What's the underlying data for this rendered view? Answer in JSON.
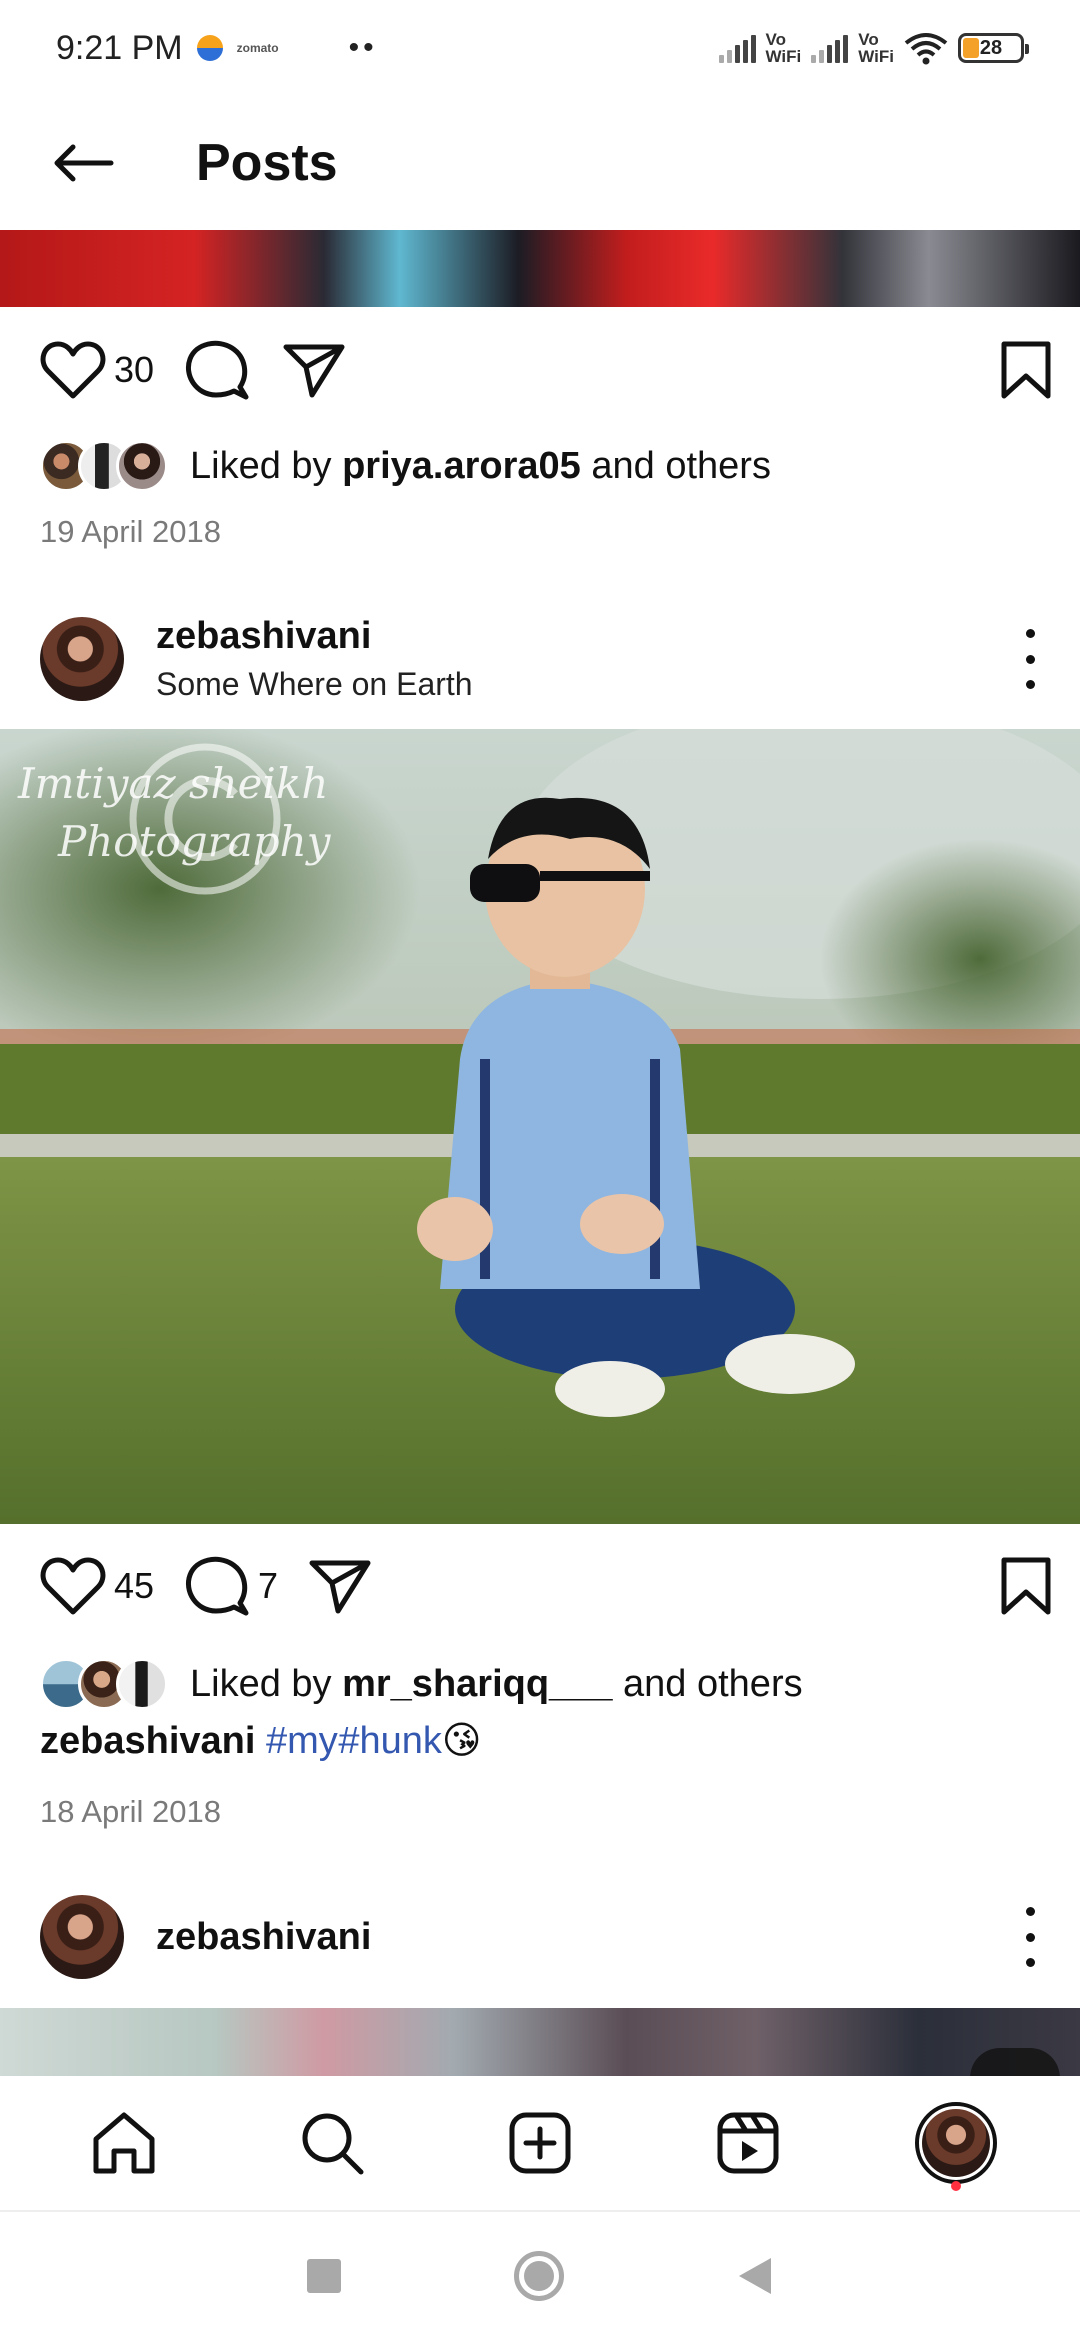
{
  "status_bar": {
    "time": "9:21 PM",
    "app_label": "zomato",
    "dots": "••",
    "vowifi_1": "Vo\nWiFi",
    "vowifi_2": "Vo\nWiFi",
    "battery": "28"
  },
  "header": {
    "title": "Posts"
  },
  "post_1": {
    "like_count": "30",
    "liked_by_prefix": "Liked by ",
    "liked_by_user": "priya.arora05",
    "liked_by_suffix": " and others",
    "date": "19 April 2018"
  },
  "post_2": {
    "username": "zebashivani",
    "location": "Some Where on Earth",
    "watermark_line1": "Imtiyaz sheikh",
    "watermark_line2": "Photography",
    "like_count": "45",
    "comment_count": "7",
    "liked_by_prefix": "Liked by ",
    "liked_by_user": "mr_shariqq___",
    "liked_by_suffix": " and others",
    "caption_user": "zebashivani",
    "caption_tag1": "#my",
    "caption_tag2": "#hunk",
    "caption_emoji": "😘",
    "date": "18 April 2018"
  },
  "post_3": {
    "username": "zebashivani"
  },
  "icons": [
    "back-arrow-icon",
    "heart-icon",
    "comment-icon",
    "share-icon",
    "bookmark-icon",
    "more-icon",
    "home-icon",
    "search-icon",
    "create-icon",
    "reels-icon",
    "profile-icon"
  ],
  "colors": {
    "hashtag": "#3458b0",
    "notification_dot": "#ff3040",
    "battery_fill": "#f4a12a"
  }
}
